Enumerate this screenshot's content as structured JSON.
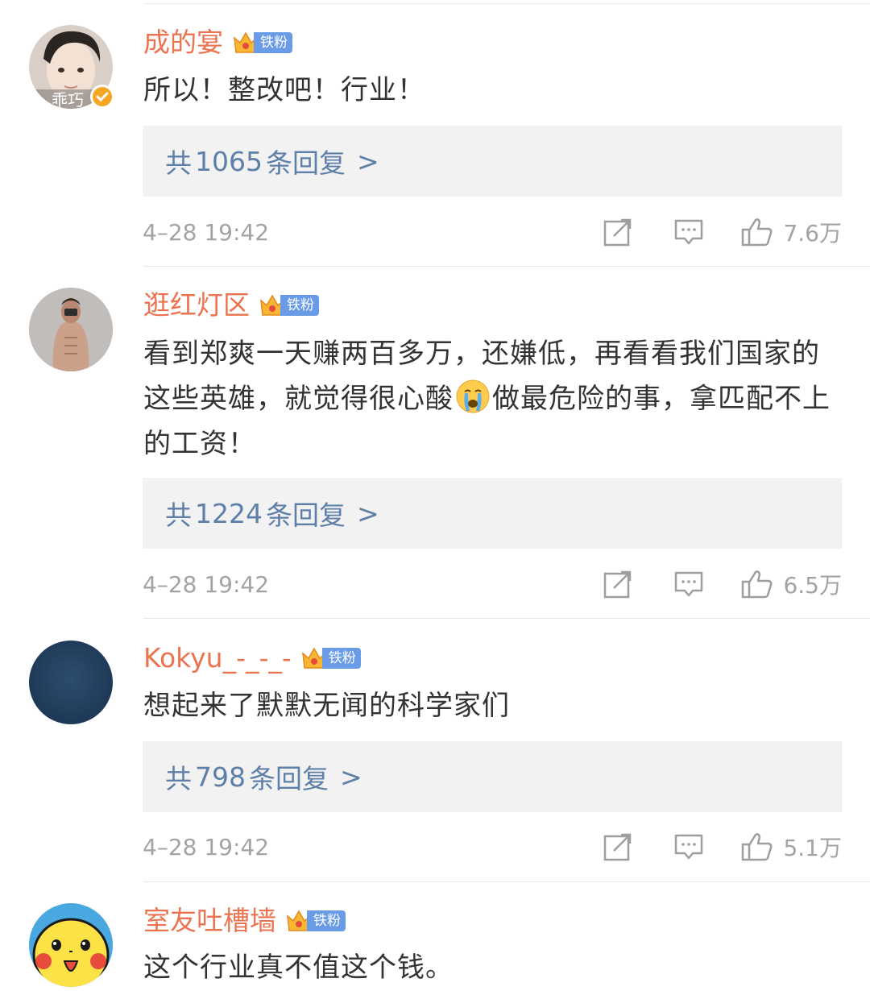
{
  "fan_badge_label": "铁粉",
  "colors": {
    "username": "#eb7350",
    "reply_link": "#5d7fa8",
    "reply_bg": "#f2f2f2",
    "meta_text": "#a3a3a3",
    "badge_blue": "#6a9be6"
  },
  "comments": [
    {
      "username": "成的宴",
      "avatar_text": "乖巧",
      "text": "所以！整改吧！行业！",
      "reply_prefix": "共",
      "reply_count": "1065",
      "reply_suffix": "条回复",
      "reply_chevron": ">",
      "timestamp": "4–28 19:42",
      "likes": "7.6万"
    },
    {
      "username": "逛红灯区",
      "text_before_emoji": "看到郑爽一天赚两百多万，还嫌低，再看看我们国家的这些英雄，就觉得很心酸",
      "emoji": "crying-face",
      "text_after_emoji": "做最危险的事，拿匹配不上的工资！",
      "reply_prefix": "共",
      "reply_count": "1224",
      "reply_suffix": "条回复",
      "reply_chevron": ">",
      "timestamp": "4–28 19:42",
      "likes": "6.5万"
    },
    {
      "username": "Kokyu_-_-_-",
      "text": "想起来了默默无闻的科学家们",
      "reply_prefix": "共",
      "reply_count": "798",
      "reply_suffix": "条回复",
      "reply_chevron": ">",
      "timestamp": "4–28 19:42",
      "likes": "5.1万"
    },
    {
      "username": "室友吐槽墙",
      "text": "这个行业真不值这个钱。"
    }
  ],
  "icons": {
    "share": "share-icon",
    "comment": "comment-icon",
    "like": "thumbs-up-icon",
    "badge": "crown-icon",
    "verified": "verified-check-icon"
  }
}
